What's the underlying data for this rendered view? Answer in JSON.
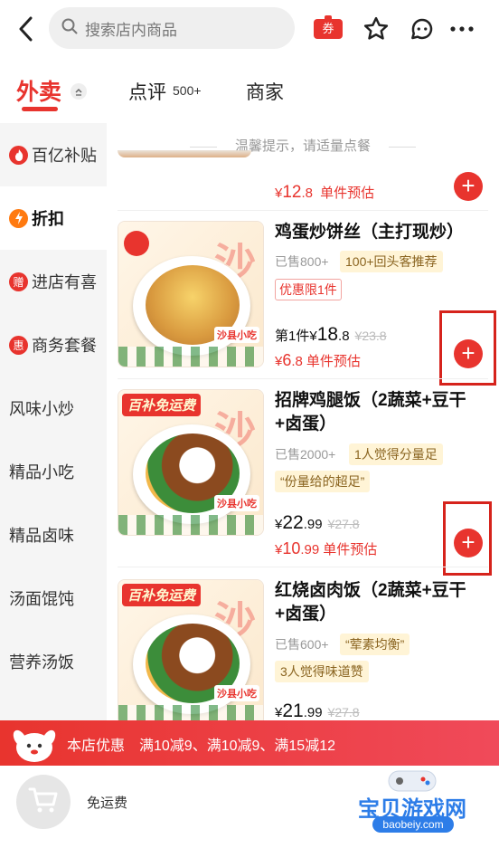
{
  "header": {
    "search_placeholder": "搜索店内商品",
    "coupon_label": "券"
  },
  "tabs": {
    "takeout": "外卖",
    "review": "点评",
    "review_count": "500+",
    "merchant": "商家"
  },
  "sidebar": {
    "items": [
      {
        "label": "百亿补贴",
        "icon": "fire-icon"
      },
      {
        "label": "折扣",
        "icon": "lightning-icon"
      },
      {
        "label": "进店有喜",
        "icon": "gift-icon",
        "icon_char": "赠"
      },
      {
        "label": "商务套餐",
        "icon": "benefit-icon",
        "icon_char": "惠"
      },
      {
        "label": "风味小炒"
      },
      {
        "label": "精品小吃"
      },
      {
        "label": "精品卤味"
      },
      {
        "label": "汤面馄饨"
      },
      {
        "label": "营养汤饭"
      }
    ]
  },
  "main": {
    "notice": "温馨提示，请适量点餐",
    "prev_item": {
      "currency": "¥",
      "est_price": "12",
      "est_decimal": ".8",
      "est_label": "单件预估"
    },
    "items": [
      {
        "name": "鸡蛋炒饼丝（主打现炒）",
        "sold": "已售800+",
        "tag": "100+回头客推荐",
        "limit": "优惠限1件",
        "price_prefix": "第1件",
        "currency": "¥",
        "price_int": "18",
        "price_dec": ".8",
        "original": "¥23.8",
        "est_currency": "¥",
        "est_int": "6",
        "est_dec": ".8",
        "est_label": "单件预估",
        "image_badge": "",
        "image_brand": "沙县小吃"
      },
      {
        "name": "招牌鸡腿饭（2蔬菜+豆干+卤蛋）",
        "sold": "已售2000+",
        "tag": "1人觉得分量足",
        "tag2": "“份量给的超足”",
        "currency": "¥",
        "price_int": "22",
        "price_dec": ".99",
        "original": "¥27.8",
        "est_currency": "¥",
        "est_int": "10",
        "est_dec": ".99",
        "est_label": "单件预估",
        "image_badge": "百补免运费",
        "image_brand": "沙县小吃"
      },
      {
        "name": "红烧卤肉饭（2蔬菜+豆干+卤蛋）",
        "sold": "已售600+",
        "tag": "“荤素均衡”",
        "tag2": "3人觉得味道赞",
        "currency": "¥",
        "price_int": "21",
        "price_dec": ".99",
        "original": "¥27.8",
        "image_badge": "百补免运费",
        "image_brand": "沙县小吃"
      }
    ]
  },
  "promo": {
    "label": "本店优惠",
    "deals": "满10减9、满10减9、满15减12"
  },
  "bottom": {
    "free_delivery": "免运费",
    "watermark": "宝贝游戏网",
    "watermark_url": "baobeiy.com"
  },
  "colors": {
    "accent": "#e8342e",
    "highlight_box": "#d6231c",
    "tag_bg": "#fff4d6"
  }
}
